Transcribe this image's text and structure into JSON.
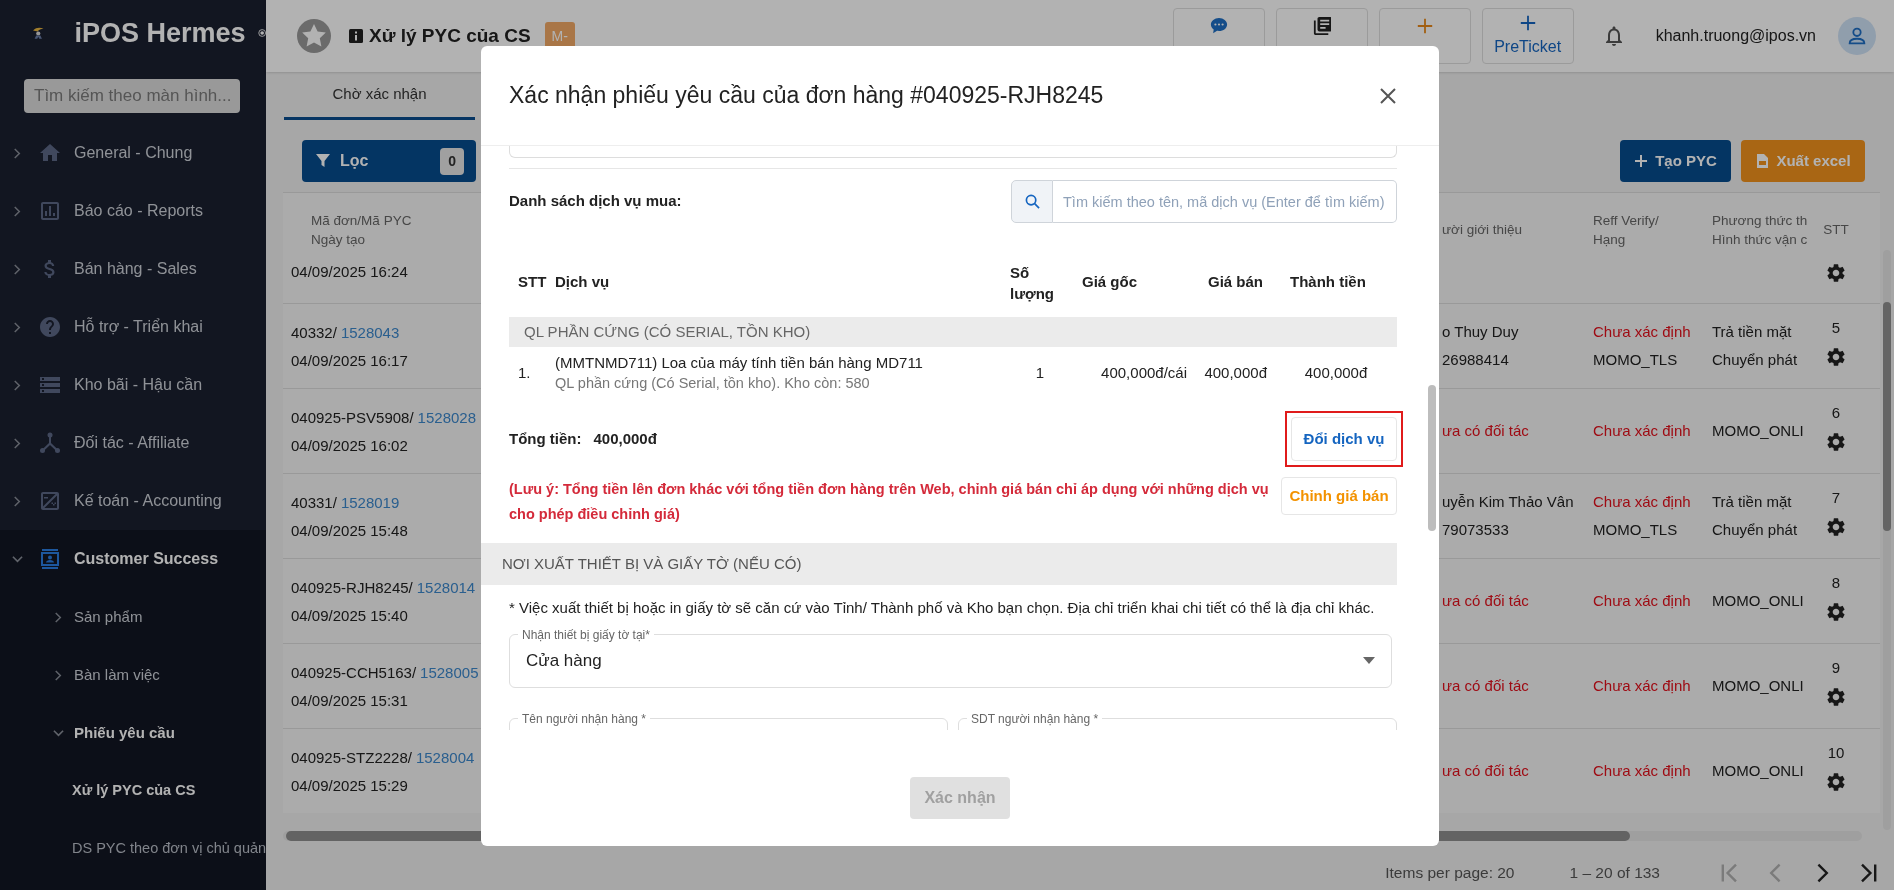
{
  "sidebar": {
    "app_name": "iPOS Hermes",
    "search": {
      "placeholder": "Tìm kiếm theo màn hình..."
    },
    "items": [
      {
        "label": "General - Chung",
        "expanded": false
      },
      {
        "label": "Báo cáo - Reports",
        "expanded": false
      },
      {
        "label": "Bán hàng - Sales",
        "expanded": false
      },
      {
        "label": "Hỗ trợ - Triển khai",
        "expanded": false
      },
      {
        "label": "Kho bãi - Hậu cần",
        "expanded": false
      },
      {
        "label": "Đối tác - Affiliate",
        "expanded": false
      },
      {
        "label": "Kế toán - Accounting",
        "expanded": false
      },
      {
        "label": "Customer Success",
        "expanded": true,
        "children": [
          {
            "label": "Sản phẩm",
            "expanded": false
          },
          {
            "label": "Bàn làm việc",
            "expanded": false
          },
          {
            "label": "Phiếu yêu cầu",
            "expanded": true,
            "children": [
              {
                "label": "Xử lý PYC của CS",
                "selected": true
              },
              {
                "label": "DS PYC theo đơn vị chủ quản",
                "selected": false
              }
            ]
          }
        ]
      }
    ]
  },
  "header": {
    "title": "Xử lý PYC của CS",
    "badge": "M-",
    "buttons": [
      {
        "kind": "chat"
      },
      {
        "kind": "book"
      },
      {
        "kind": "feedback"
      },
      {
        "label": "PreTicket",
        "kind": "ticket"
      }
    ],
    "user": "khanh.truong@ipos.vn"
  },
  "tabs": [
    {
      "label": "Chờ xác nhận",
      "selected": true
    }
  ],
  "toolbar": {
    "filter": {
      "label": "Lọc",
      "count": "0"
    },
    "buttons": [
      {
        "label": "Tạo PYC",
        "kind": "create"
      },
      {
        "label": "Xuất excel",
        "kind": "export"
      }
    ]
  },
  "table": {
    "columns": [
      {
        "lines": [
          "Mã đơn/Mã PYC",
          "Ngày tạo"
        ]
      },
      {
        "lines": [
          "ười giới thiệu"
        ]
      },
      {
        "lines": [
          "Reff Verify/",
          "Hạng"
        ]
      },
      {
        "lines": [
          "Phương thức th",
          "Hình thức vận c"
        ]
      },
      {
        "lines": [
          "STT"
        ]
      }
    ],
    "rows": [
      {
        "date": "04/09/2025 16:24"
      },
      {
        "order": "40332/",
        "request": "1528043",
        "date": "04/09/2025 16:17",
        "referrer": {
          "kind": "partner",
          "lines": [
            "o Thuy Duy",
            "26988414"
          ]
        },
        "verify": "Chưa xác định",
        "rank": "MOMO_TLS",
        "method": [
          "Trả tiền mặt",
          "Chuyển phát"
        ],
        "stt": "5"
      },
      {
        "order": "040925-PSV5908/",
        "request": "1528028",
        "date": "04/09/2025 16:02",
        "referrer": {
          "kind": "none",
          "lines": [
            "ưa có đối tác"
          ]
        },
        "verify": "Chưa xác định",
        "method": [
          "MOMO_ONLI"
        ],
        "stt": "6"
      },
      {
        "order": "40331/",
        "request": "1528019",
        "date": "04/09/2025 15:48",
        "referrer": {
          "kind": "partner",
          "lines": [
            "uyễn Kim Thảo Vân",
            "79073533"
          ]
        },
        "verify": "Chưa xác định",
        "rank": "MOMO_TLS",
        "method": [
          "Trả tiền mặt",
          "Chuyển phát"
        ],
        "stt": "7"
      },
      {
        "order": "040925-RJH8245/",
        "request": "1528014",
        "date": "04/09/2025 15:40",
        "referrer": {
          "kind": "none",
          "lines": [
            "ưa có đối tác"
          ]
        },
        "verify": "Chưa xác định",
        "method": [
          "MOMO_ONLI"
        ],
        "stt": "8"
      },
      {
        "order": "040925-CCH5163/",
        "request": "1528005",
        "date": "04/09/2025 15:31",
        "referrer": {
          "kind": "none",
          "lines": [
            "ưa có đối tác"
          ]
        },
        "verify": "Chưa xác định",
        "method": [
          "MOMO_ONLI"
        ],
        "stt": "9"
      },
      {
        "order": "040925-STZ2228/",
        "request": "1528004",
        "date": "04/09/2025 15:29",
        "referrer": {
          "kind": "none",
          "lines": [
            "ưa có đối tác"
          ]
        },
        "verify": "Chưa xác định",
        "method": [
          "MOMO_ONLI"
        ],
        "stt": "10"
      }
    ]
  },
  "pagination": {
    "items_per_page": "Items per page: 20",
    "range": "1 – 20 of 133",
    "nav": [
      {
        "kind": "first",
        "disabled": true
      },
      {
        "kind": "previous",
        "disabled": true
      },
      {
        "kind": "next",
        "disabled": false
      },
      {
        "kind": "last",
        "disabled": false
      }
    ]
  },
  "modal": {
    "title": "Xác nhận phiếu yêu cầu của đơn hàng #040925-RJH8245",
    "services_label": "Danh sách dịch vụ mua:",
    "search": {
      "placeholder": "Tìm kiếm theo tên, mã dịch vụ (Enter để tìm kiếm)"
    },
    "columns": [
      "STT",
      "Dịch vụ",
      "Số lượng",
      "Giá gốc",
      "Giá bán",
      "Thành tiền"
    ],
    "groups": [
      {
        "name": "QL PHẦN CỨNG (CÓ SERIAL, TỒN KHO)",
        "items": [
          {
            "index": "1.",
            "name": "(MMTNMD711) Loa của máy tính tiền bán hàng MD711",
            "detail": "QL phần cứng (Có Serial, tồn kho). Kho còn: 580",
            "quantity": "1",
            "base_price": "400,000đ/cái",
            "price": "400,000đ",
            "total": "400,000đ"
          }
        ]
      }
    ],
    "total_label": "Tổng tiền:",
    "total": "400,000đ",
    "change_button": {
      "label": "Đổi dịch vụ",
      "highlighted": true
    },
    "note": "(Lưu ý: Tổng tiền lên đơn khác với tổng tiền đơn hàng trên Web, chỉnh giá bán chỉ áp dụng với những dịch vụ cho phép điều chỉnh giá)",
    "edit_price_button": "Chỉnh giá bán",
    "section_title": "NƠI XUẤT THIẾT BỊ VÀ GIẤY TỜ (NẾU CÓ)",
    "section_note": "* Việc xuất thiết bị hoặc in giấy tờ sẽ căn cứ vào Tỉnh/ Thành phố và Kho bạn chọn. Địa chỉ triển khai chi tiết có thể là địa chỉ khác.",
    "receive_at": {
      "label": "Nhận thiết bị giấy tờ tại*",
      "value": "Cửa hàng"
    },
    "receiver_name": {
      "label": "Tên người nhận hàng *"
    },
    "receiver_phone": {
      "label": "SDT người nhận hàng *"
    },
    "confirm": {
      "label": "Xác nhận",
      "disabled": true
    }
  }
}
